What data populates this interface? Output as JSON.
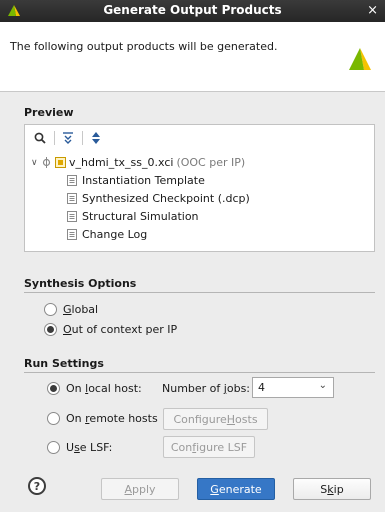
{
  "window": {
    "title": "Generate Output Products",
    "close": "×"
  },
  "header": {
    "description": "The following output products will be generated."
  },
  "preview": {
    "title": "Preview",
    "toolbar": {
      "search": "🔍",
      "collapse": "⇟",
      "expand": "⬍"
    },
    "root": {
      "name": "v_hdmi_tx_ss_0.xci",
      "note": "(OOC per IP)"
    },
    "children": [
      "Instantiation Template",
      "Synthesized Checkpoint (.dcp)",
      "Structural Simulation",
      "Change Log"
    ]
  },
  "synthesis": {
    "title": "Synthesis Options",
    "global": {
      "m": "G",
      "rest": "lobal",
      "selected": false
    },
    "ooc": {
      "m": "O",
      "rest": "ut of context per IP",
      "selected": true
    }
  },
  "run": {
    "title": "Run Settings",
    "local": {
      "pre": "On ",
      "m": "l",
      "post": "ocal host:",
      "selected": true
    },
    "jobs_label": {
      "pre": "Number of ",
      "m": "j",
      "post": "obs:"
    },
    "jobs_value": "4",
    "remote": {
      "pre": "On ",
      "m": "r",
      "post": "emote hosts",
      "selected": false
    },
    "configure_hosts": {
      "pre": "Configure ",
      "m": "H",
      "post": "osts"
    },
    "lsf": {
      "pre": "U",
      "m": "s",
      "post": "e LSF:",
      "selected": false
    },
    "configure_lsf": {
      "pre": "Con",
      "m": "f",
      "post": "igure LSF"
    }
  },
  "footer": {
    "help": "?",
    "apply": {
      "m": "A",
      "rest": "pply"
    },
    "generate": {
      "m": "G",
      "rest": "enerate"
    },
    "skip": {
      "pre": "S",
      "m": "k",
      "post": "ip"
    }
  }
}
